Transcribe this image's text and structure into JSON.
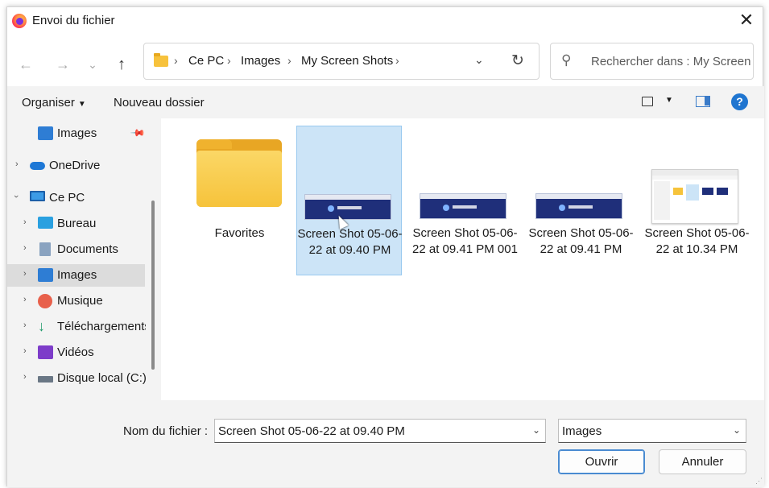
{
  "titlebar": {
    "title": "Envoi du fichier",
    "close_icon": "✕"
  },
  "nav": {
    "back_icon": "←",
    "forward_icon": "→",
    "recent_icon": "⌄",
    "up_icon": "↑",
    "breadcrumbs": [
      "Ce PC",
      "Images",
      "My Screen Shots"
    ],
    "separator": "›",
    "dropdown_icon": "⌄",
    "refresh_icon": "↻",
    "search_placeholder": "Rechercher dans : My Screen ..."
  },
  "toolbar": {
    "organize": "Organiser",
    "new_folder": "Nouveau dossier",
    "help": "?"
  },
  "sidebar": {
    "items": [
      {
        "label": "Images",
        "icon": "images-icon",
        "pinned": true
      },
      {
        "label": "OneDrive",
        "icon": "onedrive-icon"
      },
      {
        "label": "Ce PC",
        "icon": "pc-icon",
        "expanded": true
      },
      {
        "label": "Bureau",
        "icon": "desktop-icon"
      },
      {
        "label": "Documents",
        "icon": "documents-icon"
      },
      {
        "label": "Images",
        "icon": "images-icon",
        "selected": true
      },
      {
        "label": "Musique",
        "icon": "music-icon"
      },
      {
        "label": "Téléchargements",
        "icon": "downloads-icon"
      },
      {
        "label": "Vidéos",
        "icon": "videos-icon"
      },
      {
        "label": "Disque local (C:)",
        "icon": "disk-icon"
      }
    ]
  },
  "files": [
    {
      "label": "Favorites",
      "type": "folder"
    },
    {
      "label": "Screen Shot 05-06-22 at 09.40 PM",
      "type": "image",
      "selected": true
    },
    {
      "label": "Screen Shot 05-06-22 at 09.41 PM 001",
      "type": "image"
    },
    {
      "label": "Screen Shot 05-06-22 at 09.41 PM",
      "type": "image"
    },
    {
      "label": "Screen Shot 05-06-22 at 10.34 PM",
      "type": "image"
    }
  ],
  "footer": {
    "filename_label": "Nom du fichier :",
    "filename_value": "Screen Shot 05-06-22 at 09.40 PM",
    "filetype_value": "Images",
    "open_label": "Ouvrir",
    "cancel_label": "Annuler"
  },
  "colors": {
    "accent": "#1f75d0",
    "selection": "#cce4f7",
    "folder": "#f6c33b"
  }
}
